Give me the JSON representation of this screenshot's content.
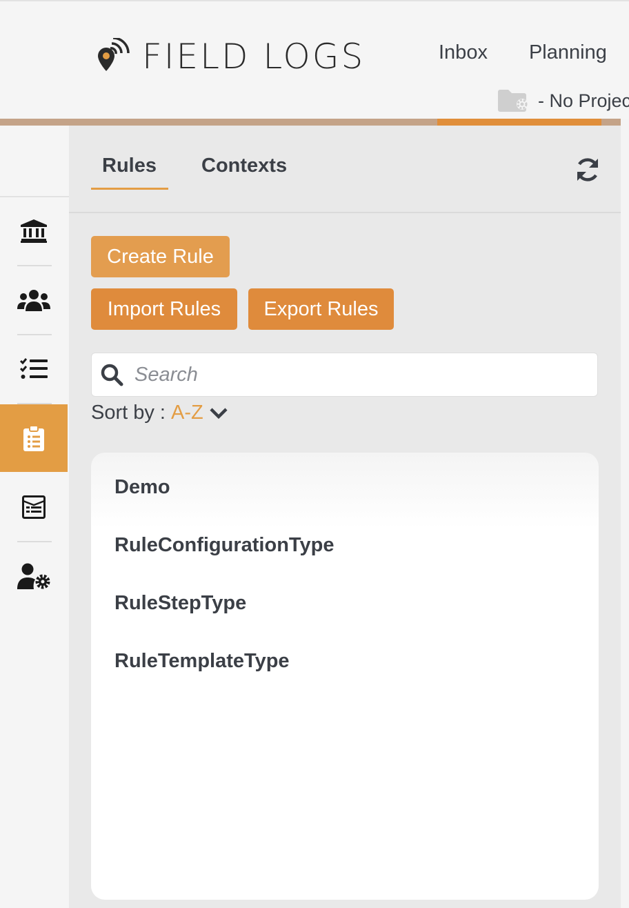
{
  "header": {
    "brand": "FIELD LOGS",
    "nav": [
      "Inbox",
      "Planning"
    ],
    "project": "- No Projec"
  },
  "sidebar": {
    "items": [
      {
        "icon": "bank-icon"
      },
      {
        "icon": "users-icon"
      },
      {
        "icon": "checklist-icon"
      },
      {
        "icon": "clipboard-list-icon",
        "active": true
      },
      {
        "icon": "form-icon"
      },
      {
        "icon": "user-gear-icon"
      }
    ]
  },
  "tabs": {
    "rules": "Rules",
    "contexts": "Contexts",
    "active": "Rules"
  },
  "actions": {
    "create": "Create Rule",
    "import": "Import Rules",
    "export": "Export Rules"
  },
  "search": {
    "placeholder": "Search",
    "value": ""
  },
  "sort": {
    "label": "Sort by :",
    "value": "A-Z"
  },
  "rules": [
    "Demo",
    "RuleConfigurationType",
    "RuleStepType",
    "RuleTemplateType"
  ],
  "colors": {
    "accent": "#e39d44",
    "button": "#df8b3c",
    "text": "#3b3f46"
  }
}
